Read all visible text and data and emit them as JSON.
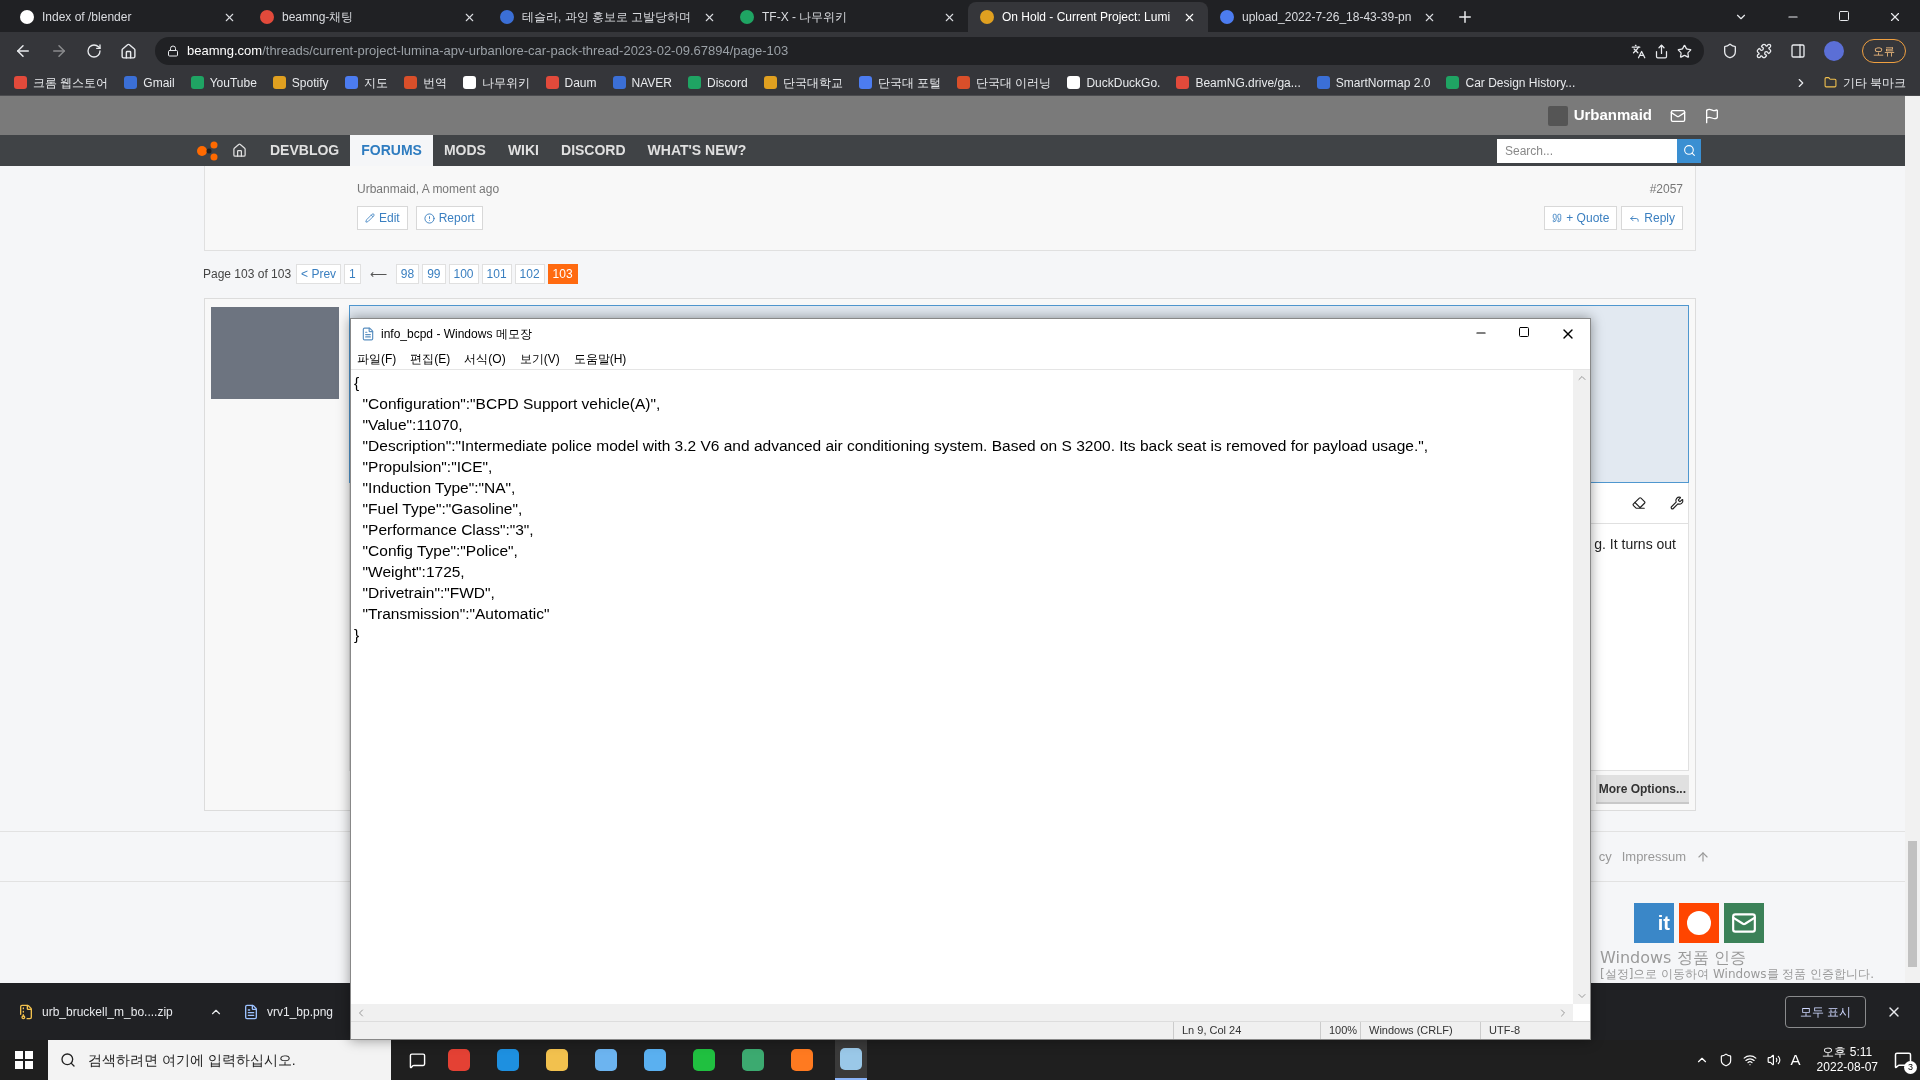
{
  "browser": {
    "tabs": [
      {
        "title": "Index of /blender",
        "selected": false
      },
      {
        "title": "beamng-채팅",
        "selected": false
      },
      {
        "title": "테슬라, 과잉 홍보로 고발당하며",
        "selected": false
      },
      {
        "title": "TF-X - 나무위키",
        "selected": false
      },
      {
        "title": "On Hold - Current Project: Lumi",
        "selected": true
      },
      {
        "title": "upload_2022-7-26_18-43-39-pn",
        "selected": false
      }
    ],
    "url_host": "beamng.com",
    "url_path": "/threads/current-project-lumina-apv-urbanlore-car-pack-thread-2023-02-09.67894/page-103",
    "profile_badge": "오류",
    "bookmarks": [
      "크롬 웹스토어",
      "Gmail",
      "YouTube",
      "Spotify",
      "지도",
      "번역",
      "나무위키",
      "Daum",
      "NAVER",
      "Discord",
      "단국대학교",
      "단국대 포털",
      "단국대 이러닝",
      "DuckDuckGo.",
      "BeamNG.drive/ga...",
      "SmartNormap 2.0",
      "Car Design History..."
    ],
    "other_bookmarks": "기타 북마크"
  },
  "forum": {
    "username": "Urbanmaid",
    "search_placeholder": "Search...",
    "nav": [
      {
        "label": "DEVBLOG",
        "selected": false
      },
      {
        "label": "FORUMS",
        "selected": true
      },
      {
        "label": "MODS",
        "selected": false
      },
      {
        "label": "WIKI",
        "selected": false
      },
      {
        "label": "DISCORD",
        "selected": false
      },
      {
        "label": "WHAT'S NEW?",
        "selected": false
      }
    ],
    "post": {
      "byline": "Urbanmaid, A moment ago",
      "number": "#2057",
      "left_actions": [
        "Edit",
        "Report"
      ],
      "right_actions": [
        "+ Quote",
        "Reply"
      ]
    },
    "pagination": {
      "label": "Page 103 of 103",
      "prev": "< Prev",
      "pages": [
        {
          "kind": "page",
          "label": "1",
          "selected": false
        },
        {
          "kind": "gap",
          "label": "⟵"
        },
        {
          "kind": "page",
          "label": "98",
          "selected": false
        },
        {
          "kind": "page",
          "label": "99",
          "selected": false
        },
        {
          "kind": "page",
          "label": "100",
          "selected": false
        },
        {
          "kind": "page",
          "label": "101",
          "selected": false
        },
        {
          "kind": "page",
          "label": "102",
          "selected": false
        },
        {
          "kind": "page",
          "label": "103",
          "selected": true
        }
      ]
    },
    "reply": {
      "text": "g. It turns out",
      "more_options": "More Options..."
    },
    "footer_links": [
      "cy",
      "Impressum"
    ],
    "share_partial": "it"
  },
  "notepad": {
    "title": "info_bcpd - Windows 메모장",
    "menu": [
      "파일(F)",
      "편집(E)",
      "서식(O)",
      "보기(V)",
      "도움말(H)"
    ],
    "lines": [
      "{",
      "  \"Configuration\":\"BCPD Support vehicle(A)\",",
      "  \"Value\":11070,",
      "  \"Description\":\"Intermediate police model with 3.2 V6 and advanced air conditioning system. Based on S 3200. Its back seat is removed for payload usage.\",",
      "  \"Propulsion\":\"ICE\",",
      "  \"Induction Type\":\"NA\",",
      "  \"Fuel Type\":\"Gasoline\",",
      "  \"Performance Class\":\"3\",",
      "  \"Config Type\":\"Police\",",
      "  \"Weight\":1725,",
      "  \"Drivetrain\":\"FWD\",",
      "  \"Transmission\":\"Automatic\"",
      "}"
    ],
    "status": [
      "Ln 9, Col 24",
      "100%",
      "Windows (CRLF)",
      "UTF-8"
    ]
  },
  "downloads": {
    "items": [
      "urb_bruckell_m_bo....zip",
      "vrv1_bp.png"
    ],
    "show_all": "모두 표시"
  },
  "activation": {
    "title": "Windows 정품 인증",
    "text": "[설정]으로 이동하여 Windows를 정품 인증합니다."
  },
  "taskbar": {
    "search_placeholder": "검색하려면 여기에 입력하십시오.",
    "ime": "A",
    "time": "오후 5:11",
    "date": "2022-08-07",
    "notifications": "3"
  }
}
